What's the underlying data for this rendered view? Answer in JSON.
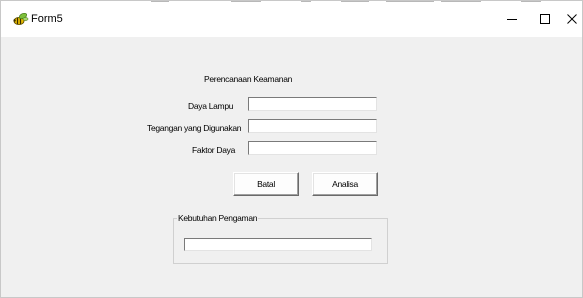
{
  "window": {
    "title": "Form5",
    "app_icon": "bee-icon",
    "controls": {
      "minimize_glyph": "–",
      "maximize_glyph": "☐",
      "close_glyph": "✕"
    }
  },
  "form": {
    "heading": "Perencanaan Keamanan",
    "fields": [
      {
        "label": "Daya Lampu",
        "value": ""
      },
      {
        "label": "Tegangan yang Digunakan",
        "value": ""
      },
      {
        "label": "Faktor Daya",
        "value": ""
      }
    ],
    "buttons": {
      "cancel": "Batal",
      "analyze": "Analisa"
    },
    "result_group": {
      "legend": "Kebutuhan Pengaman",
      "value": ""
    }
  },
  "colors": {
    "client_background": "#f0f0f0",
    "titlebar_background": "#ffffff"
  }
}
